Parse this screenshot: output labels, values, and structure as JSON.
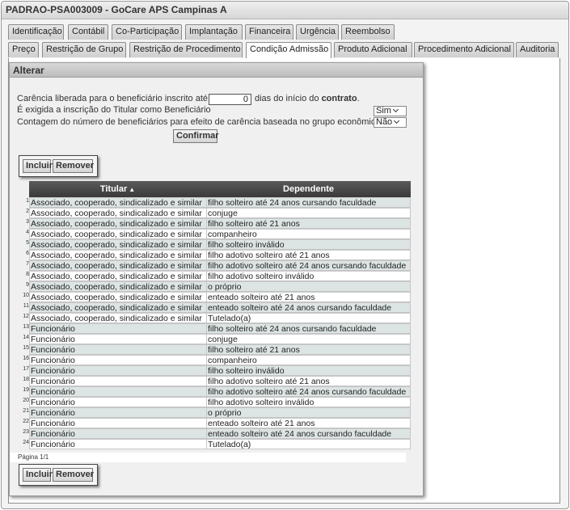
{
  "window": {
    "title": "PADRAO-PSA003009 - GoCare APS Campinas A"
  },
  "tabs_row1": [
    "Identificação",
    "Contábil",
    "Co-Participação",
    "Implantação",
    "Financeira",
    "Urgência",
    "Reembolso"
  ],
  "tabs_row2": [
    "Preço",
    "Restrição de Grupo",
    "Restrição de Procedimento",
    "Condição Admissão",
    "Produto Adicional",
    "Procedimento Adicional",
    "Auditoria"
  ],
  "active_tab": "Condição Admissão",
  "panel": {
    "title": "Alterar",
    "carencia_prefix": "Carência liberada para o beneficiário inscrito até",
    "carencia_value": "0",
    "carencia_suffix_normal": "dias do início do",
    "carencia_suffix_bold": "contrato",
    "carencia_end": ".",
    "titular_question": "É exigida a inscrição do Titular como Beneficiário",
    "titular_value": "Sim",
    "contagem_question": "Contagem do número de beneficiários para efeito de carência baseada no grupo econômico",
    "contagem_value": "Não",
    "confirm_label": "Confirmar",
    "include_label": "Incluir",
    "remove_label": "Remover"
  },
  "grid": {
    "headers": [
      "Titular",
      "Dependente"
    ],
    "sort_indicator": "▲",
    "rows": [
      [
        "1",
        "Associado, cooperado, sindicalizado e similar",
        "filho solteiro até 24 anos cursando faculdade"
      ],
      [
        "2",
        "Associado, cooperado, sindicalizado e similar",
        "conjuge"
      ],
      [
        "3",
        "Associado, cooperado, sindicalizado e similar",
        "filho solteiro até 21 anos"
      ],
      [
        "4",
        "Associado, cooperado, sindicalizado e similar",
        "companheiro"
      ],
      [
        "5",
        "Associado, cooperado, sindicalizado e similar",
        "filho solteiro inválido"
      ],
      [
        "6",
        "Associado, cooperado, sindicalizado e similar",
        "filho adotivo solteiro até 21 anos"
      ],
      [
        "7",
        "Associado, cooperado, sindicalizado e similar",
        "filho adotivo solteiro até 24 anos cursando faculdade"
      ],
      [
        "8",
        "Associado, cooperado, sindicalizado e similar",
        "filho adotivo solteiro inválido"
      ],
      [
        "9",
        "Associado, cooperado, sindicalizado e similar",
        "o próprio"
      ],
      [
        "10",
        "Associado, cooperado, sindicalizado e similar",
        "enteado solteiro até 21 anos"
      ],
      [
        "11",
        "Associado, cooperado, sindicalizado e similar",
        "enteado solteiro até 24 anos cursando faculdade"
      ],
      [
        "12",
        "Associado, cooperado, sindicalizado e similar",
        "Tutelado(a)"
      ],
      [
        "13",
        "Funcionário",
        "filho solteiro até 24 anos cursando faculdade"
      ],
      [
        "14",
        "Funcionário",
        "conjuge"
      ],
      [
        "15",
        "Funcionário",
        "filho solteiro até 21 anos"
      ],
      [
        "16",
        "Funcionário",
        "companheiro"
      ],
      [
        "17",
        "Funcionário",
        "filho solteiro inválido"
      ],
      [
        "18",
        "Funcionário",
        "filho adotivo solteiro até 21 anos"
      ],
      [
        "19",
        "Funcionário",
        "filho adotivo solteiro até 24 anos cursando faculdade"
      ],
      [
        "20",
        "Funcionário",
        "filho adotivo solteiro inválido"
      ],
      [
        "21",
        "Funcionário",
        "o próprio"
      ],
      [
        "22",
        "Funcionário",
        "enteado solteiro até 21 anos"
      ],
      [
        "23",
        "Funcionário",
        "enteado solteiro até 24 anos cursando faculdade"
      ],
      [
        "24",
        "Funcionário",
        "Tutelado(a)"
      ]
    ],
    "pager_text": "Página 1/1"
  }
}
